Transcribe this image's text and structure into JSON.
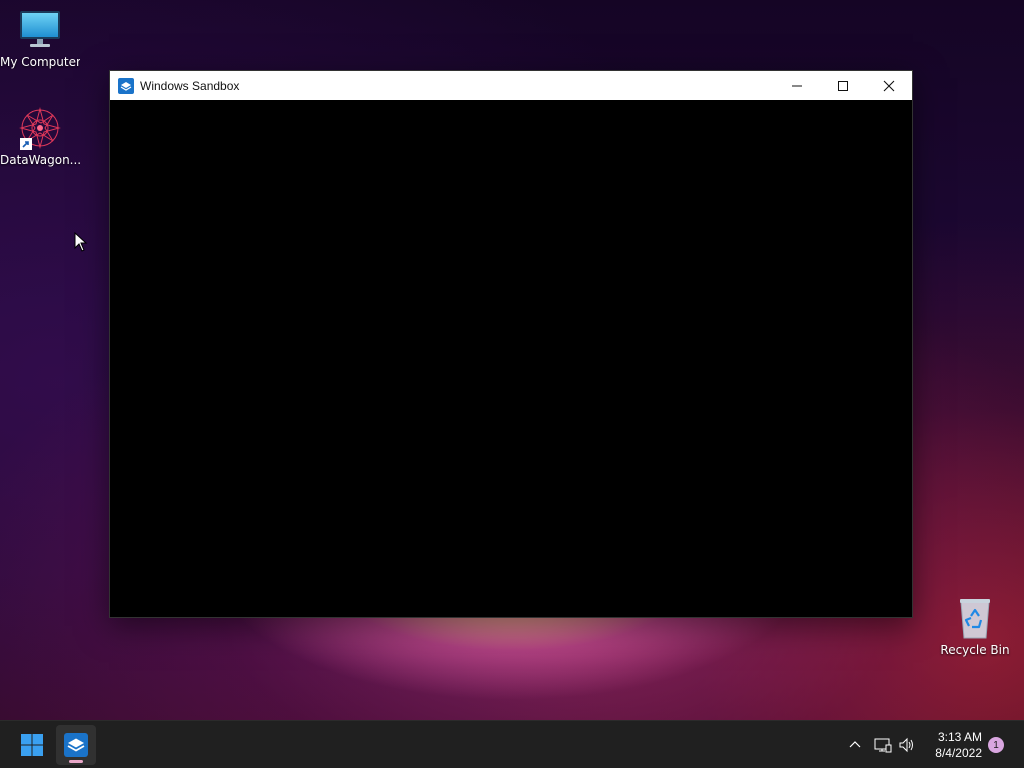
{
  "desktop": {
    "icons": [
      {
        "label": "My Computer",
        "icon": "monitor-icon"
      },
      {
        "label": "DataWagon...",
        "icon": "datawagon-icon"
      },
      {
        "label": "Recycle Bin",
        "icon": "recycle-bin-icon"
      }
    ]
  },
  "window": {
    "title": "Windows Sandbox",
    "icon": "sandbox-icon",
    "controls": [
      "minimize-icon",
      "maximize-icon",
      "close-icon"
    ]
  },
  "taskbar": {
    "start_icon": "windows-logo-icon",
    "pinned": [
      {
        "name": "Windows Sandbox",
        "icon": "sandbox-icon",
        "active": true
      }
    ],
    "tray": {
      "icons": [
        "chevron-up-icon",
        "network-icon",
        "volume-icon"
      ],
      "time": "3:13 AM",
      "date": "8/4/2022",
      "notification_count": "1"
    }
  },
  "colors": {
    "taskbar_bg": "#202020",
    "window_content": "#000000",
    "titlebar_bg": "#ffffff",
    "accent": "#1a73c9"
  }
}
